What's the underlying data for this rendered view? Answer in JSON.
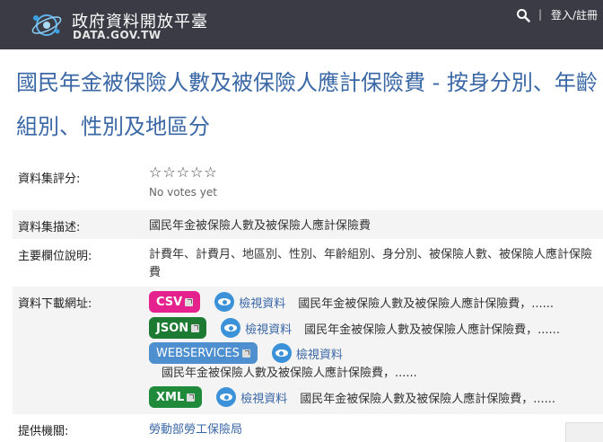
{
  "header": {
    "site_name": "政府資料開放平臺",
    "site_domain": "DATA.GOV.TW",
    "search_icon": "search-icon",
    "separator": "|",
    "login_label": "登入/註冊",
    "background_color": "#3a3b45"
  },
  "dataset": {
    "title": "國民年金被保險人數及被保險人應計保險費 - 按身分別、年齡組別、性別及地區分"
  },
  "fields": {
    "rating": {
      "label": "資料集評分:",
      "stars": "☆☆☆☆☆",
      "votes": "No votes yet"
    },
    "description": {
      "label": "資料集描述:",
      "value": "國民年金被保險人數及被保險人應計保險費"
    },
    "columns": {
      "label": "主要欄位說明:",
      "value": "計費年、計費月、地區別、性別、年齡組別、身分別、被保險人數、被保險人應計保險費"
    },
    "downloads": {
      "label": "資料下載網址:",
      "view_label": "檢視資料",
      "items": [
        {
          "format": "CSV",
          "color": "#e5218e",
          "desc": "國民年金被保險人數及被保險人應計保險費，......"
        },
        {
          "format": "JSON",
          "color": "#1d7a32",
          "desc": "國民年金被保險人數及被保險人應計保險費，......"
        },
        {
          "format": "WEBSERVICES",
          "color": "#4d8fcf",
          "desc": "國民年金被保險人數及被保險人應計保險費，......"
        },
        {
          "format": "XML",
          "color": "#1f8a3a",
          "desc": "國民年金被保險人數及被保險人應計保險費，......"
        }
      ]
    },
    "agency": {
      "label": "提供機關:",
      "value": "勞動部勞工保險局"
    }
  }
}
